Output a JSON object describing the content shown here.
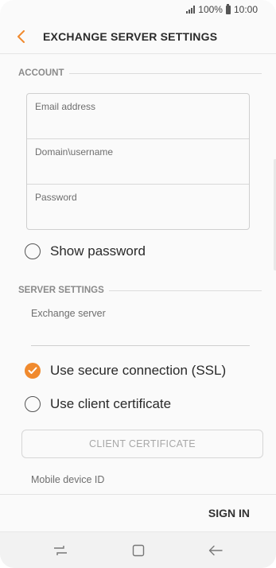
{
  "status_bar": {
    "battery_percent": "100%",
    "time": "10:00"
  },
  "header": {
    "title": "EXCHANGE SERVER SETTINGS"
  },
  "account": {
    "section_title": "ACCOUNT",
    "fields": [
      {
        "label": "Email address",
        "value": ""
      },
      {
        "label": "Domain\\username",
        "value": ""
      },
      {
        "label": "Password",
        "value": ""
      }
    ],
    "show_password_label": "Show password"
  },
  "server": {
    "section_title": "SERVER SETTINGS",
    "exchange_server_label": "Exchange server",
    "ssl_label": "Use secure connection (SSL)",
    "ssl_checked": true,
    "client_cert_option_label": "Use client certificate",
    "client_cert_checked": false,
    "client_certificate_button": "CLIENT CERTIFICATE",
    "mobile_device_id_label": "Mobile device ID"
  },
  "footer": {
    "sign_in_label": "SIGN IN"
  },
  "icons": {
    "back": "chevron-left-icon",
    "recent": "recent-apps-icon",
    "home": "home-icon",
    "nav_back": "nav-back-icon",
    "checked": "check-icon"
  },
  "colors": {
    "accent": "#f08a2e",
    "background": "#fafafa"
  }
}
